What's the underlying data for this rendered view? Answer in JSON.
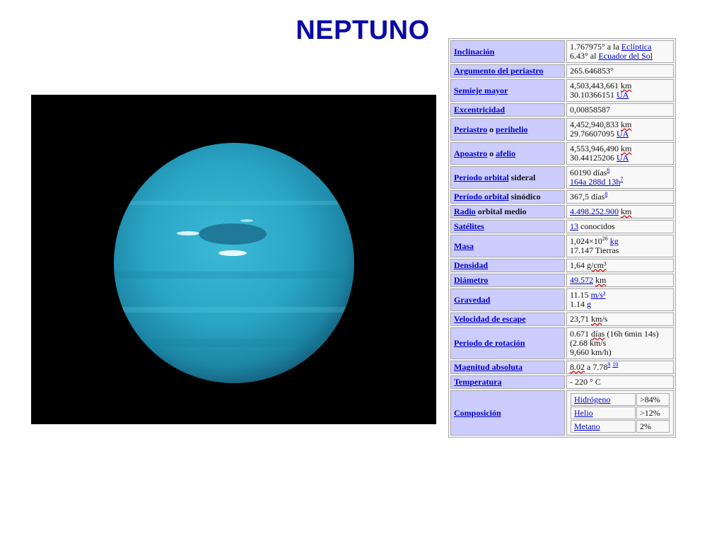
{
  "slide": {
    "title": "NEPTUNO"
  },
  "colors": {
    "title": "#0a0aa8",
    "key_bg": "#ccccff",
    "link": "#0000cc",
    "planet": "#2aa5c4"
  },
  "table": {
    "inclinacion": {
      "label": "Inclinación",
      "l1a": "1.767975° a la ",
      "l1b": "Eclíptica",
      "l2a": "6.43° al ",
      "l2b": "Ecuador del Sol"
    },
    "argumento": {
      "label": "Argumento del periastro",
      "v": "265.646853°"
    },
    "semieje": {
      "label": "Semieje mayor",
      "l1a": "4,503,443,661 ",
      "l1b": "km",
      "l2a": "30.10366151 ",
      "l2b": "UA"
    },
    "excentricidad": {
      "label": "Excentricidad",
      "v": "0,00858587"
    },
    "periastro": {
      "label_a": "Periastro",
      "label_b": " o ",
      "label_c": "perihelio",
      "l1a": "4,452,940,833 ",
      "l1b": "km",
      "l2a": "29.76607095 ",
      "l2b": "UA"
    },
    "apoastro": {
      "label_a": "Apoastro",
      "label_b": " o ",
      "label_c": "afelio",
      "l1a": "4,553,946,490 ",
      "l1b": "km",
      "l2a": "30.44125206 ",
      "l2b": "UA"
    },
    "periodo_sideral": {
      "label_a": "Período orbital",
      "label_b": " sideral",
      "l1": "60190 días",
      "l1sup": "6",
      "l2": "164a 288d 13h",
      "l2sup": "7"
    },
    "periodo_sinodico": {
      "label_a": "Período orbital",
      "label_b": " sinódico",
      "v": "367,5 días",
      "vsup": "8"
    },
    "radio": {
      "label_a": "Radio",
      "label_b": " orbital medio",
      "va": "4.498.252.900",
      "vb": "km"
    },
    "satelites": {
      "label": "Satélites",
      "va": "13",
      "vb": " conocidos"
    },
    "masa": {
      "label": "Masa",
      "l1a": "1,024×10",
      "l1sup": "26",
      "l1b": "kg",
      "l2": "17.147 Tierras"
    },
    "densidad": {
      "label": "Densidad",
      "va": "1,64 ",
      "vb": "g/cm³"
    },
    "diametro": {
      "label": "Diámetro",
      "va": "49.572",
      "vb": "km"
    },
    "gravedad": {
      "label": "Gravedad",
      "l1a": "11.15 ",
      "l1b": "m/s²",
      "l2a": "1.14 ",
      "l2b": "g"
    },
    "velocidad": {
      "label": "Velocidad de escape",
      "va": "23,71 ",
      "vb": "km",
      "vc": "/s"
    },
    "rotacion": {
      "label": "Periodo de rotación",
      "l1a": "0.671 ",
      "l1b": "días",
      "l1c": " (16h 6min 14s)",
      "l2": "(2.68 km/s",
      "l3": "9,660 km/h)"
    },
    "magnitud": {
      "label": "Magnitud absoluta",
      "va": "8.02",
      "vb": " a 7.78",
      "vsup1": "9",
      "vsup2": "10"
    },
    "temperatura": {
      "label": "Temperatura",
      "v": "- 220 ° C"
    },
    "composicion": {
      "label": "Composición",
      "items": [
        {
          "name": "Hidrógeno",
          "pct": ">84%"
        },
        {
          "name": "Helio",
          "pct": ">12%"
        },
        {
          "name": "Metano",
          "pct": "2%"
        }
      ]
    }
  }
}
